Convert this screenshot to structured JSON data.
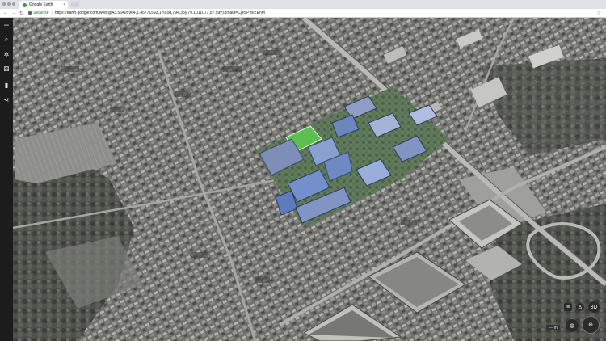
{
  "browser": {
    "tab_title": "Google Earth",
    "tab_close": "×",
    "secure_label": "Sécurisé",
    "url": "https://earth.google.com/web/@43.56405964,1.45771592,170.0d,794,35y,79.1011077,57.59y,0r/data=Cj4SPBIIZEhMMTA...",
    "back_icon": "arrow-left-icon",
    "forward_icon": "arrow-right-icon",
    "reload_icon": "reload-icon"
  },
  "sidebar": {
    "items": [
      {
        "name": "menu-icon",
        "glyph": "☰"
      },
      {
        "name": "search-icon",
        "glyph": "⌕"
      },
      {
        "name": "voyager-icon",
        "glyph": "✲"
      },
      {
        "name": "feeling-lucky-icon",
        "glyph": "⚄"
      },
      {
        "name": "bookmark-icon",
        "glyph": "▮"
      },
      {
        "name": "share-icon",
        "glyph": "<"
      }
    ]
  },
  "map_controls": {
    "layers_icon": "layers-icon",
    "pegman_icon": "pegman-icon",
    "view_3d_label": "3D",
    "compass_icon": "compass-icon",
    "globe_icon": "globe-icon",
    "scale_label": "— m"
  },
  "colors": {
    "sidebar_bg": "#1c1c1c",
    "highlight_green": "#55bb4a",
    "highlight_blue": "#6f8fc8",
    "terrain_gray": "#6d6e6a"
  }
}
